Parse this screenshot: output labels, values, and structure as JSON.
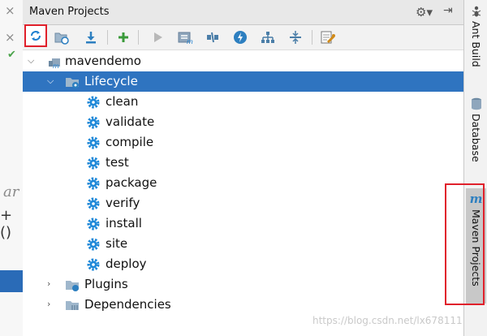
{
  "panel": {
    "title": "Maven Projects"
  },
  "editor": {
    "fragment1": "ar",
    "fragment2": "+()"
  },
  "toolbar": {
    "buttons": [
      {
        "name": "reimport-all-maven-projects",
        "icon": "refresh-icon"
      },
      {
        "name": "generate-sources",
        "icon": "folder-refresh-icon"
      },
      {
        "name": "download-sources",
        "icon": "download-icon"
      },
      {
        "name": "add-maven-project",
        "icon": "plus-icon"
      },
      {
        "name": "run-maven-build",
        "icon": "play-icon"
      },
      {
        "name": "execute-maven-goal",
        "icon": "maven-goal-icon"
      },
      {
        "name": "toggle-offline-mode",
        "icon": "offline-icon"
      },
      {
        "name": "toggle-skip-tests",
        "icon": "lightning-icon"
      },
      {
        "name": "show-dependencies",
        "icon": "hierarchy-icon"
      },
      {
        "name": "collapse-all",
        "icon": "collapse-icon"
      },
      {
        "name": "maven-settings",
        "icon": "settings-wrench-icon"
      }
    ]
  },
  "tree": {
    "project": "mavendemo",
    "lifecycle": "Lifecycle",
    "goals": [
      "clean",
      "validate",
      "compile",
      "test",
      "package",
      "verify",
      "install",
      "site",
      "deploy"
    ],
    "plugins": "Plugins",
    "dependencies": "Dependencies"
  },
  "right_tabs": {
    "ant": "Ant Build",
    "database": "Database",
    "maven": "Maven Projects"
  },
  "watermark": "https://blog.csdn.net/lx678111",
  "colors": {
    "selection": "#2f74c0",
    "highlight": "#e0202b",
    "gear": "#1e88d8"
  }
}
